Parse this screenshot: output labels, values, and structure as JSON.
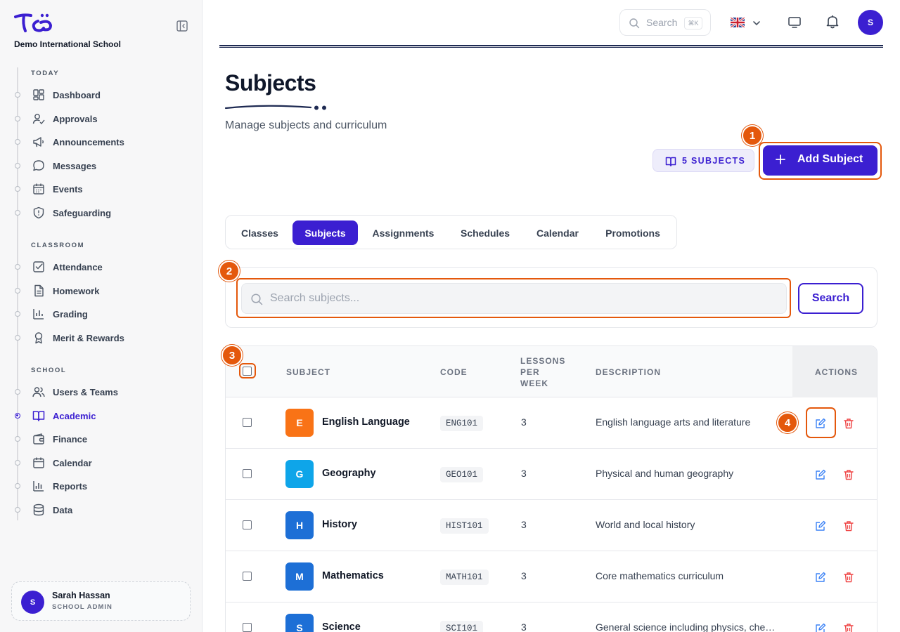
{
  "sidebar": {
    "school_name": "Demo International School",
    "sections": [
      {
        "title": "TODAY",
        "items": [
          {
            "label": "Dashboard",
            "icon": "dashboard-icon"
          },
          {
            "label": "Approvals",
            "icon": "user-check-icon"
          },
          {
            "label": "Announcements",
            "icon": "megaphone-icon"
          },
          {
            "label": "Messages",
            "icon": "chat-bubble-icon"
          },
          {
            "label": "Events",
            "icon": "calendar-grid-icon"
          },
          {
            "label": "Safeguarding",
            "icon": "shield-icon"
          }
        ]
      },
      {
        "title": "CLASSROOM",
        "items": [
          {
            "label": "Attendance",
            "icon": "checkbox-icon"
          },
          {
            "label": "Homework",
            "icon": "document-icon"
          },
          {
            "label": "Grading",
            "icon": "bar-chart-icon"
          },
          {
            "label": "Merit & Rewards",
            "icon": "award-icon"
          }
        ]
      },
      {
        "title": "SCHOOL",
        "items": [
          {
            "label": "Users & Teams",
            "icon": "users-icon"
          },
          {
            "label": "Academic",
            "icon": "open-book-icon",
            "active": true
          },
          {
            "label": "Finance",
            "icon": "wallet-icon"
          },
          {
            "label": "Calendar",
            "icon": "calendar-icon"
          },
          {
            "label": "Reports",
            "icon": "reports-chart-icon"
          },
          {
            "label": "Data",
            "icon": "database-icon"
          }
        ]
      }
    ],
    "user": {
      "initial": "S",
      "name": "Sarah Hassan",
      "role": "SCHOOL ADMIN"
    }
  },
  "topbar": {
    "search_placeholder": "Search",
    "search_shortcut": "⌘K",
    "language_flag": "uk-flag-icon",
    "avatar_initial": "S"
  },
  "header": {
    "title": "Subjects",
    "subtitle": "Manage subjects and curriculum",
    "count_badge": "5 SUBJECTS",
    "add_button": "Add Subject"
  },
  "tabs": [
    "Classes",
    "Subjects",
    "Assignments",
    "Schedules",
    "Calendar",
    "Promotions"
  ],
  "active_tab": "Subjects",
  "search": {
    "placeholder": "Search subjects...",
    "value": "",
    "button": "Search"
  },
  "table": {
    "columns": {
      "subject": "SUBJECT",
      "code": "CODE",
      "lessons_line1": "LESSONS",
      "lessons_line2": "PER",
      "lessons_line3": "WEEK",
      "description": "DESCRIPTION",
      "actions": "ACTIONS"
    },
    "rows": [
      {
        "initial": "E",
        "color": "#f97316",
        "name": "English Language",
        "code": "ENG101",
        "lessons": "3",
        "description": "English language arts and literature"
      },
      {
        "initial": "G",
        "color": "#0ea5e9",
        "name": "Geography",
        "code": "GEO101",
        "lessons": "3",
        "description": "Physical and human geography"
      },
      {
        "initial": "H",
        "color": "#1d6fd6",
        "name": "History",
        "code": "HIST101",
        "lessons": "3",
        "description": "World and local history"
      },
      {
        "initial": "M",
        "color": "#1d6fd6",
        "name": "Mathematics",
        "code": "MATH101",
        "lessons": "3",
        "description": "Core mathematics curriculum"
      },
      {
        "initial": "S",
        "color": "#1d6fd6",
        "name": "Science",
        "code": "SCI101",
        "lessons": "3",
        "description": "General science including physics, chemistry and biology"
      }
    ]
  },
  "annotations": [
    "1",
    "2",
    "3",
    "4"
  ],
  "colors": {
    "accent": "#3b1fd1",
    "annotation": "#e4580c",
    "edit": "#3b82f6",
    "delete": "#ef4444"
  }
}
